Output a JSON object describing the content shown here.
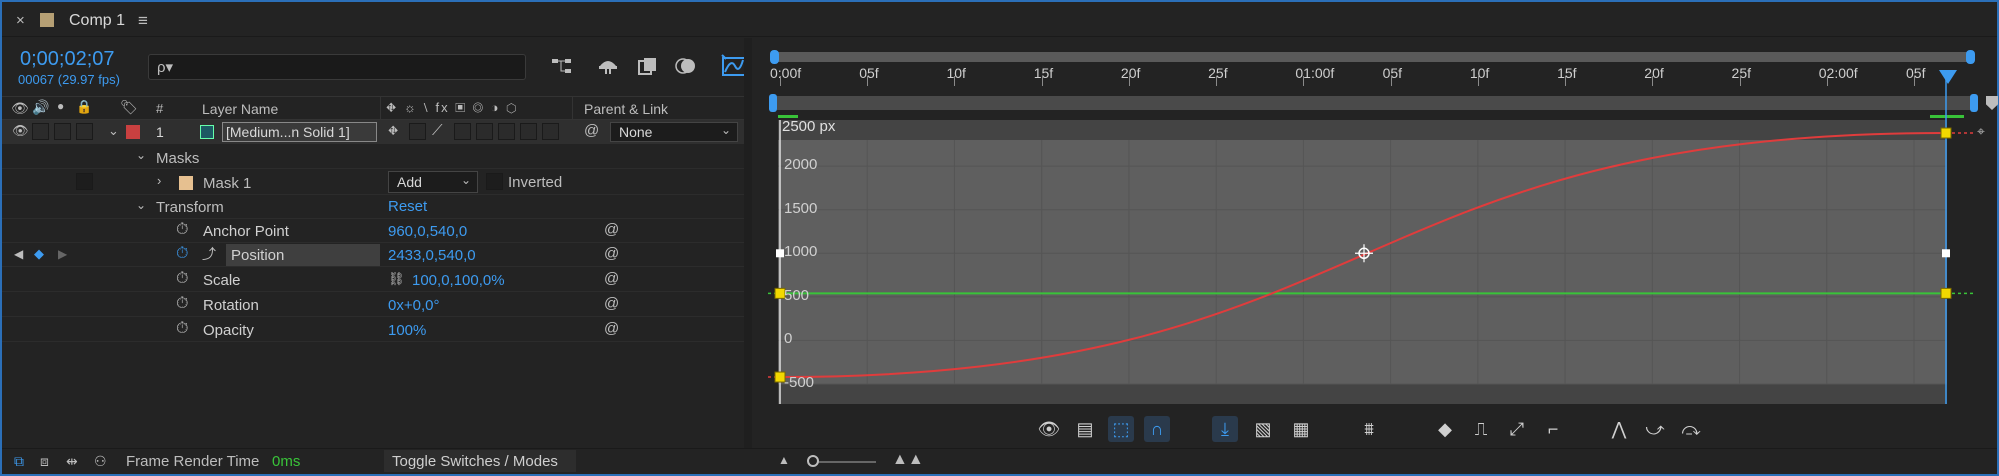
{
  "window": {
    "tab_title": "Comp 1",
    "close_glyph": "×",
    "menu_glyph": "≡",
    "swatch_color": "#b59f74"
  },
  "timecode": {
    "current": "0;00;02;07",
    "frames_fps": "00067 (29.97 fps)"
  },
  "search": {
    "placeholder": "ρ▾"
  },
  "columns": {
    "hash": "#",
    "layer_name": "Layer Name",
    "parent_link": "Parent & Link",
    "switch_glyphs": "⛖ ☼ ⧵ fx ▣ ◎ ◑ ⬡"
  },
  "layer": {
    "number": "1",
    "name": "[Medium...n Solid 1]",
    "parent": "None",
    "label_color": "#c94040",
    "type_color": "#1d5a63"
  },
  "masks": {
    "group_label": "Masks",
    "mask_name": "Mask 1",
    "mask_color": "#e6c090",
    "mode": "Add",
    "inverted_label": "Inverted"
  },
  "transform": {
    "group_label": "Transform",
    "reset_label": "Reset",
    "properties": [
      {
        "name": "Anchor Point",
        "value": "960,0,540,0"
      },
      {
        "name": "Position",
        "value": "2433,0,540,0"
      },
      {
        "name": "Scale",
        "value": "100,0,100,0%"
      },
      {
        "name": "Rotation",
        "value": "0x+0,0°"
      },
      {
        "name": "Opacity",
        "value": "100%"
      }
    ]
  },
  "footer": {
    "render_time_label": "Frame Render Time",
    "render_time_value": "0ms",
    "toggle_label": "Toggle Switches / Modes"
  },
  "timeline": {
    "ruler": [
      "0:00f",
      "05f",
      "10f",
      "15f",
      "20f",
      "25f",
      "01:00f",
      "05f",
      "10f",
      "15f",
      "20f",
      "25f",
      "02:00f",
      "05f"
    ]
  },
  "graph": {
    "unit_label": "2500 px",
    "y_ticks": [
      "2000",
      "1500",
      "1000",
      "500",
      "0",
      "-500"
    ],
    "y_range": [
      -500,
      2500
    ]
  },
  "chart_data": {
    "type": "line",
    "x_unit": "frames",
    "x": [
      0,
      67
    ],
    "series": [
      {
        "name": "",
        "color": "#e03c3c",
        "points": [
          [
            0,
            -420
          ],
          [
            67,
            2380
          ]
        ]
      },
      {
        "name": "",
        "color": "#39c339",
        "points": [
          [
            0,
            540
          ],
          [
            67,
            540
          ]
        ]
      }
    ],
    "ylim": [
      -500,
      2500
    ]
  },
  "colors": {
    "accent": "#3d9bf0",
    "curve_red": "#e03c3c",
    "curve_green": "#39c339",
    "keyframe_yellow": "#f2d800",
    "render_green": "#39c339"
  }
}
